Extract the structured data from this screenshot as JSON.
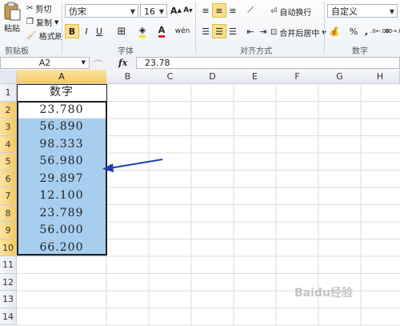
{
  "ribbon": {
    "clipboard": {
      "paste": "粘贴",
      "cut": "剪切",
      "copy": "复制",
      "format_painter": "格式刷",
      "label": "剪贴板"
    },
    "font": {
      "name": "仿宋",
      "size": "16",
      "grow": "A",
      "shrink": "A",
      "bold": "B",
      "italic": "I",
      "underline": "U",
      "color_letter": "A",
      "phonetic": "wén",
      "label": "字体"
    },
    "alignment": {
      "wrap_text": "自动换行",
      "merge_center": "合并后居中",
      "label": "对齐方式"
    },
    "number": {
      "format": "自定义",
      "percent": "%",
      "comma": ",",
      "inc_decimal": ".0←.00",
      "dec_decimal": ".00→.0",
      "label": "数字"
    }
  },
  "formula_bar": {
    "name_box": "A2",
    "fx": "fx",
    "content": "23.78"
  },
  "columns": [
    "A",
    "B",
    "C",
    "D",
    "E",
    "F",
    "G",
    "H"
  ],
  "rows": [
    "1",
    "2",
    "3",
    "4",
    "5",
    "6",
    "7",
    "8",
    "9",
    "10",
    "11",
    "12",
    "13",
    "14"
  ],
  "cells": {
    "header": "数字",
    "values": [
      "23.780",
      "56.890",
      "98.333",
      "56.980",
      "29.897",
      "12.100",
      "23.789",
      "56.000",
      "66.200"
    ]
  },
  "watermark": "Baidu经验",
  "colors": {
    "selection": "#a7cdef",
    "header_selected": "#f5c862",
    "arrow": "#1f3fa8"
  }
}
